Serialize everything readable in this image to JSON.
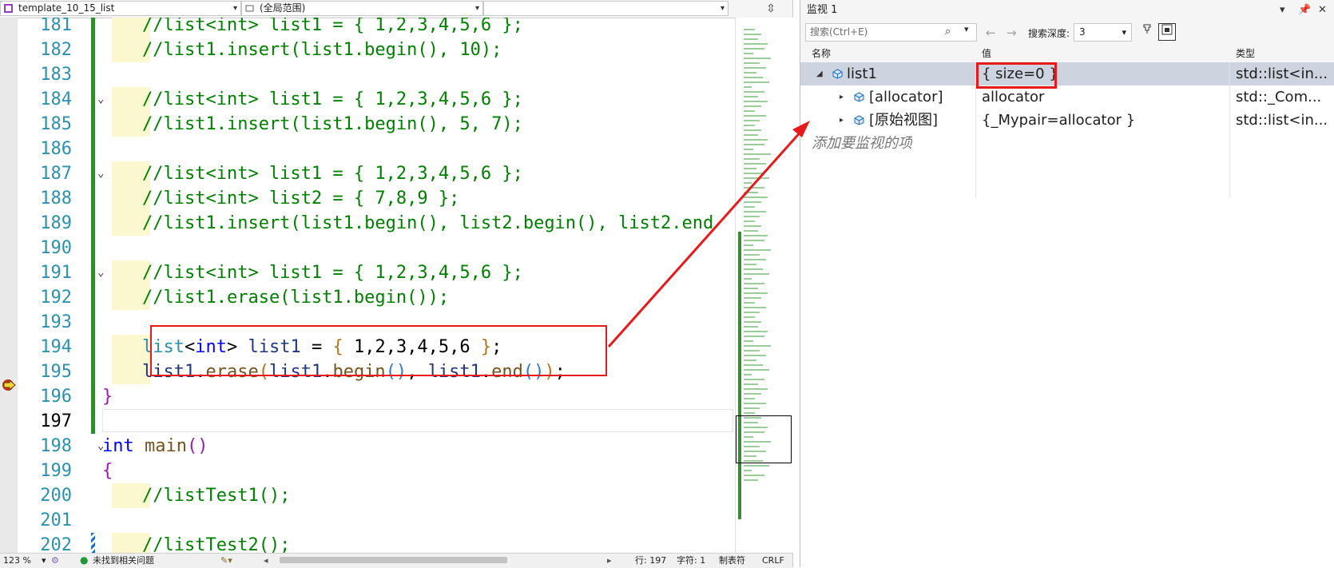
{
  "editor": {
    "file_dropdown": "template_10_15_list",
    "scope_dropdown": "(全局范围)",
    "member_dropdown": "",
    "split_icon": "split-icon",
    "lines": [
      {
        "n": "181",
        "segs": [
          {
            "c": "cm",
            "t": "//list<int> list1 = { 1,2,3,4,5,6 };"
          }
        ]
      },
      {
        "n": "182",
        "segs": [
          {
            "c": "cm",
            "t": "//list1.insert(list1.begin(), 10);"
          }
        ]
      },
      {
        "n": "183",
        "segs": []
      },
      {
        "n": "184",
        "fold": true,
        "segs": [
          {
            "c": "cm",
            "t": "//list<int> list1 = { 1,2,3,4,5,6 };"
          }
        ]
      },
      {
        "n": "185",
        "segs": [
          {
            "c": "cm",
            "t": "//list1.insert(list1.begin(), 5, 7);"
          }
        ]
      },
      {
        "n": "186",
        "segs": []
      },
      {
        "n": "187",
        "fold": true,
        "segs": [
          {
            "c": "cm",
            "t": "//list<int> list1 = { 1,2,3,4,5,6 };"
          }
        ]
      },
      {
        "n": "188",
        "segs": [
          {
            "c": "cm",
            "t": "//list<int> list2 = { 7,8,9 };"
          }
        ]
      },
      {
        "n": "189",
        "segs": [
          {
            "c": "cm",
            "t": "//list1.insert(list1.begin(), list2.begin(), list2.end"
          }
        ]
      },
      {
        "n": "190",
        "segs": []
      },
      {
        "n": "191",
        "fold": true,
        "segs": [
          {
            "c": "cm",
            "t": "//list<int> list1 = { 1,2,3,4,5,6 };"
          }
        ]
      },
      {
        "n": "192",
        "segs": [
          {
            "c": "cm",
            "t": "//list1.erase(list1.begin());"
          }
        ]
      },
      {
        "n": "193",
        "segs": []
      },
      {
        "n": "194",
        "segs": [
          {
            "c": "ty",
            "t": "list"
          },
          {
            "c": "pl",
            "t": "<"
          },
          {
            "c": "kw",
            "t": "int"
          },
          {
            "c": "pl",
            "t": "> "
          },
          {
            "c": "vr",
            "t": "list1"
          },
          {
            "c": "pl",
            "t": " = "
          },
          {
            "c": "br1",
            "t": "{"
          },
          {
            "c": "pl",
            "t": " 1,2,3,4,5,6 "
          },
          {
            "c": "br1",
            "t": "}"
          },
          {
            "c": "pl",
            "t": ";"
          }
        ]
      },
      {
        "n": "195",
        "segs": [
          {
            "c": "vr",
            "t": "list1"
          },
          {
            "c": "pl",
            "t": "."
          },
          {
            "c": "fn",
            "t": "erase"
          },
          {
            "c": "br1",
            "t": "("
          },
          {
            "c": "vr",
            "t": "list1"
          },
          {
            "c": "pl",
            "t": "."
          },
          {
            "c": "fn",
            "t": "begin"
          },
          {
            "c": "br2",
            "t": "()"
          },
          {
            "c": "pl",
            "t": ", "
          },
          {
            "c": "vr",
            "t": "list1"
          },
          {
            "c": "pl",
            "t": "."
          },
          {
            "c": "fn",
            "t": "end"
          },
          {
            "c": "br2",
            "t": "()"
          },
          {
            "c": "br1",
            "t": ")"
          },
          {
            "c": "pl",
            "t": ";"
          }
        ]
      },
      {
        "n": "196",
        "segs": [
          {
            "c": "br3",
            "t": "}"
          }
        ],
        "brace": true
      },
      {
        "n": "197",
        "segs": [],
        "current": true
      },
      {
        "n": "198",
        "fold": true,
        "segs": [
          {
            "c": "kw",
            "t": "int"
          },
          {
            "c": "pl",
            "t": " "
          },
          {
            "c": "fn",
            "t": "main"
          },
          {
            "c": "br3",
            "t": "()"
          }
        ],
        "top": true
      },
      {
        "n": "199",
        "segs": [
          {
            "c": "br3",
            "t": "{"
          }
        ],
        "brace": true
      },
      {
        "n": "200",
        "segs": [
          {
            "c": "cm",
            "t": "//listTest1();"
          }
        ]
      },
      {
        "n": "201",
        "segs": []
      },
      {
        "n": "202",
        "segs": [
          {
            "c": "cm",
            "t": "//listTest2();"
          }
        ]
      }
    ]
  },
  "status": {
    "zoom": "123 %",
    "issues": "未找到相关问题",
    "line": "行: 197",
    "char": "字符: 1",
    "tabs": "制表符",
    "eol": "CRLF"
  },
  "watch": {
    "title": "监视 1",
    "search_placeholder": "搜索(Ctrl+E)",
    "depth_label": "搜索深度:",
    "depth_value": "3",
    "columns": {
      "name": "名称",
      "value": "值",
      "type": "类型"
    },
    "rows": [
      {
        "name": "list1",
        "value": "{ size=0 }",
        "type": "std::list<in..."
      },
      {
        "name": "[allocator]",
        "value": "allocator",
        "type": "std::_Com..."
      },
      {
        "name": "[原始视图]",
        "value": "{_Mypair=allocator }",
        "type": "std::list<in..."
      }
    ],
    "add_item": "添加要监视的项"
  },
  "colors": {
    "comment": "#008000",
    "keyword": "#0000ff",
    "type": "#2b91af",
    "annotation": "#e8191b",
    "change_bar": "#2e8b2e"
  }
}
